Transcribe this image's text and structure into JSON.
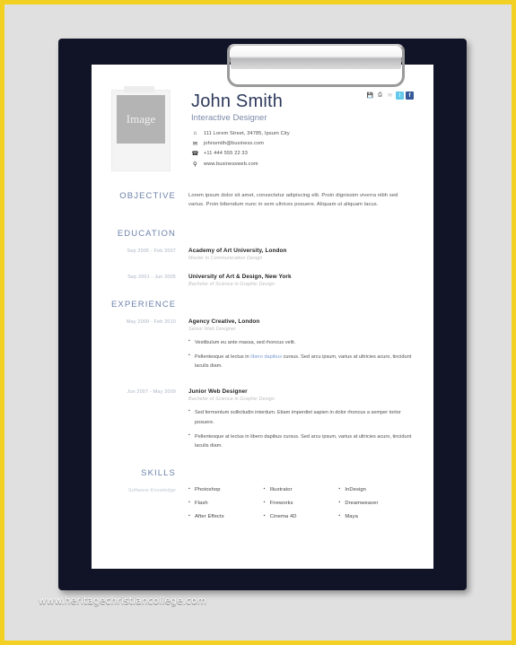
{
  "watermark": "www.heritagechristiancollege.com",
  "theme": {
    "outer_border": "#f2d024",
    "background": "#e0e0e0",
    "clipboard": "#111327",
    "paper": "#ffffff",
    "heading_blue": "#6d82ab",
    "name_blue": "#2e3a5c",
    "role_blue": "#7b8aa8",
    "date_gray": "#a9b2c4",
    "link_blue": "#7c9ad4"
  },
  "header": {
    "photo_placeholder": "Image",
    "name": "John Smith",
    "role": "Interactive Designer",
    "contact": [
      {
        "icon": "home-icon",
        "glyph": "⌂",
        "text": "111 Lorem Street,  34785,  Ipsum City"
      },
      {
        "icon": "envelope-icon",
        "glyph": "✉",
        "text": "johnsmith@business.com"
      },
      {
        "icon": "phone-icon",
        "glyph": "☎",
        "text": "+11 444 555 22 33"
      },
      {
        "icon": "search-globe-icon",
        "glyph": "⚲",
        "text": "www.businessweb.com"
      }
    ],
    "socials": [
      {
        "name": "save-icon",
        "glyph": "💾",
        "class": "s-save"
      },
      {
        "name": "print-icon",
        "glyph": "⎙",
        "class": "s-print"
      },
      {
        "name": "email-icon",
        "glyph": "✉",
        "class": "s-mail"
      },
      {
        "name": "twitter-icon",
        "glyph": "t",
        "class": "s-tw"
      },
      {
        "name": "facebook-icon",
        "glyph": "f",
        "class": "s-fb"
      }
    ]
  },
  "objective": {
    "title": "OBJECTIVE",
    "text": "Lorem ipsum dolor sit amet, consectetur adipiscing elit. Proin dignissim viverra nibh sed varius. Proin bibendum nunc in sem ultrices posuere. Aliquam ut aliquam lacus."
  },
  "education": {
    "title": "EDUCATION",
    "entries": [
      {
        "date": "Sep 2005 - Feb 2007",
        "title": "Academy of Art University, London",
        "sub": "Master in Communication Design"
      },
      {
        "date": "Sep 2001 - Jun 2005",
        "title": "University of Art & Design, New York",
        "sub": "Bachelor of Science in Graphic Design"
      }
    ]
  },
  "experience": {
    "title": "EXPERIENCE",
    "entries": [
      {
        "date": "May 2009 - Feb 2010",
        "title": "Agency Creative, London",
        "sub": "Senior Web Designer",
        "bullets": [
          {
            "pre": "Vestibulum eu ante massa, sed rhoncus velit.",
            "link": "",
            "post": ""
          },
          {
            "pre": "Pellentesque at lectus in ",
            "link": "libero dapibus",
            "post": " cursus. Sed arcu ipsum, varius at ultricies acuro, tincidunt laculis diam."
          }
        ]
      },
      {
        "date": "Jun 2007 - May 2009",
        "title": "Junior Web Designer",
        "sub": "Bachelor of Science in Graphic Design",
        "bullets": [
          {
            "pre": "Sed fermentum sollicitudin interdum. Etiam imperdiet sapien in dolor rhoncus a semper tortor posuere.",
            "link": "",
            "post": ""
          },
          {
            "pre": "Pellentesque at lectus in libero dapibus cursus. Sed arcu ipsum, varius at ultricies acuro, tincidunt laculis diam.",
            "link": "",
            "post": ""
          }
        ]
      }
    ]
  },
  "skills": {
    "title": "SKILLS",
    "sub_label": "Software Knowledge",
    "columns": [
      [
        "Photoshop",
        "Flash",
        "After Effects"
      ],
      [
        "Illustrator",
        "Fireworks",
        "Cinema 4D"
      ],
      [
        "InDesign",
        "Dreamweaver",
        "Maya"
      ]
    ]
  }
}
